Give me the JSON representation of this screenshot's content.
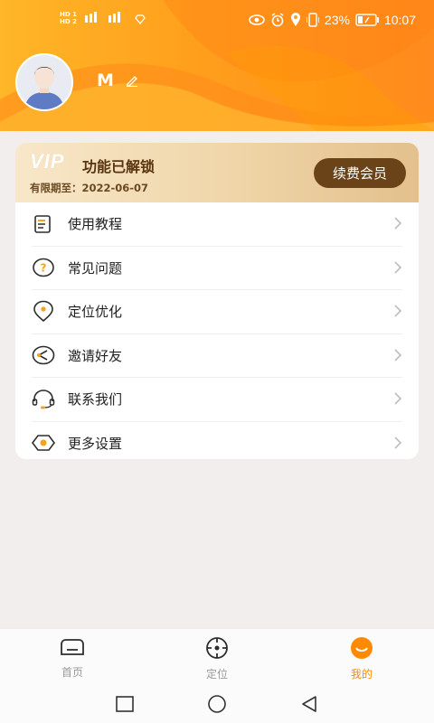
{
  "statusbar": {
    "left_sim1": "HD 1",
    "left_sim2": "HD 2",
    "battery": "23%",
    "time": "10:07"
  },
  "profile": {
    "username": "M"
  },
  "vip": {
    "logo": "VIP",
    "title": "功能已解锁",
    "expiry": "有限期至：2022-06-07",
    "renew_label": "续费会员"
  },
  "menu": {
    "items": [
      {
        "label": "使用教程",
        "icon": "tutorial-icon"
      },
      {
        "label": "常见问题",
        "icon": "question-icon"
      },
      {
        "label": "定位优化",
        "icon": "location-pin-icon"
      },
      {
        "label": "邀请好友",
        "icon": "share-icon"
      },
      {
        "label": "联系我们",
        "icon": "headset-icon"
      },
      {
        "label": "更多设置",
        "icon": "settings-hexagon-icon"
      }
    ]
  },
  "tabs": [
    {
      "label": "首页",
      "icon": "home-icon",
      "active": false
    },
    {
      "label": "定位",
      "icon": "crosshair-icon",
      "active": false
    },
    {
      "label": "我的",
      "icon": "smile-icon",
      "active": true
    }
  ],
  "colors": {
    "accent": "#ff8a00",
    "vip_button": "#6a4418",
    "header": "#ff9f1c"
  }
}
